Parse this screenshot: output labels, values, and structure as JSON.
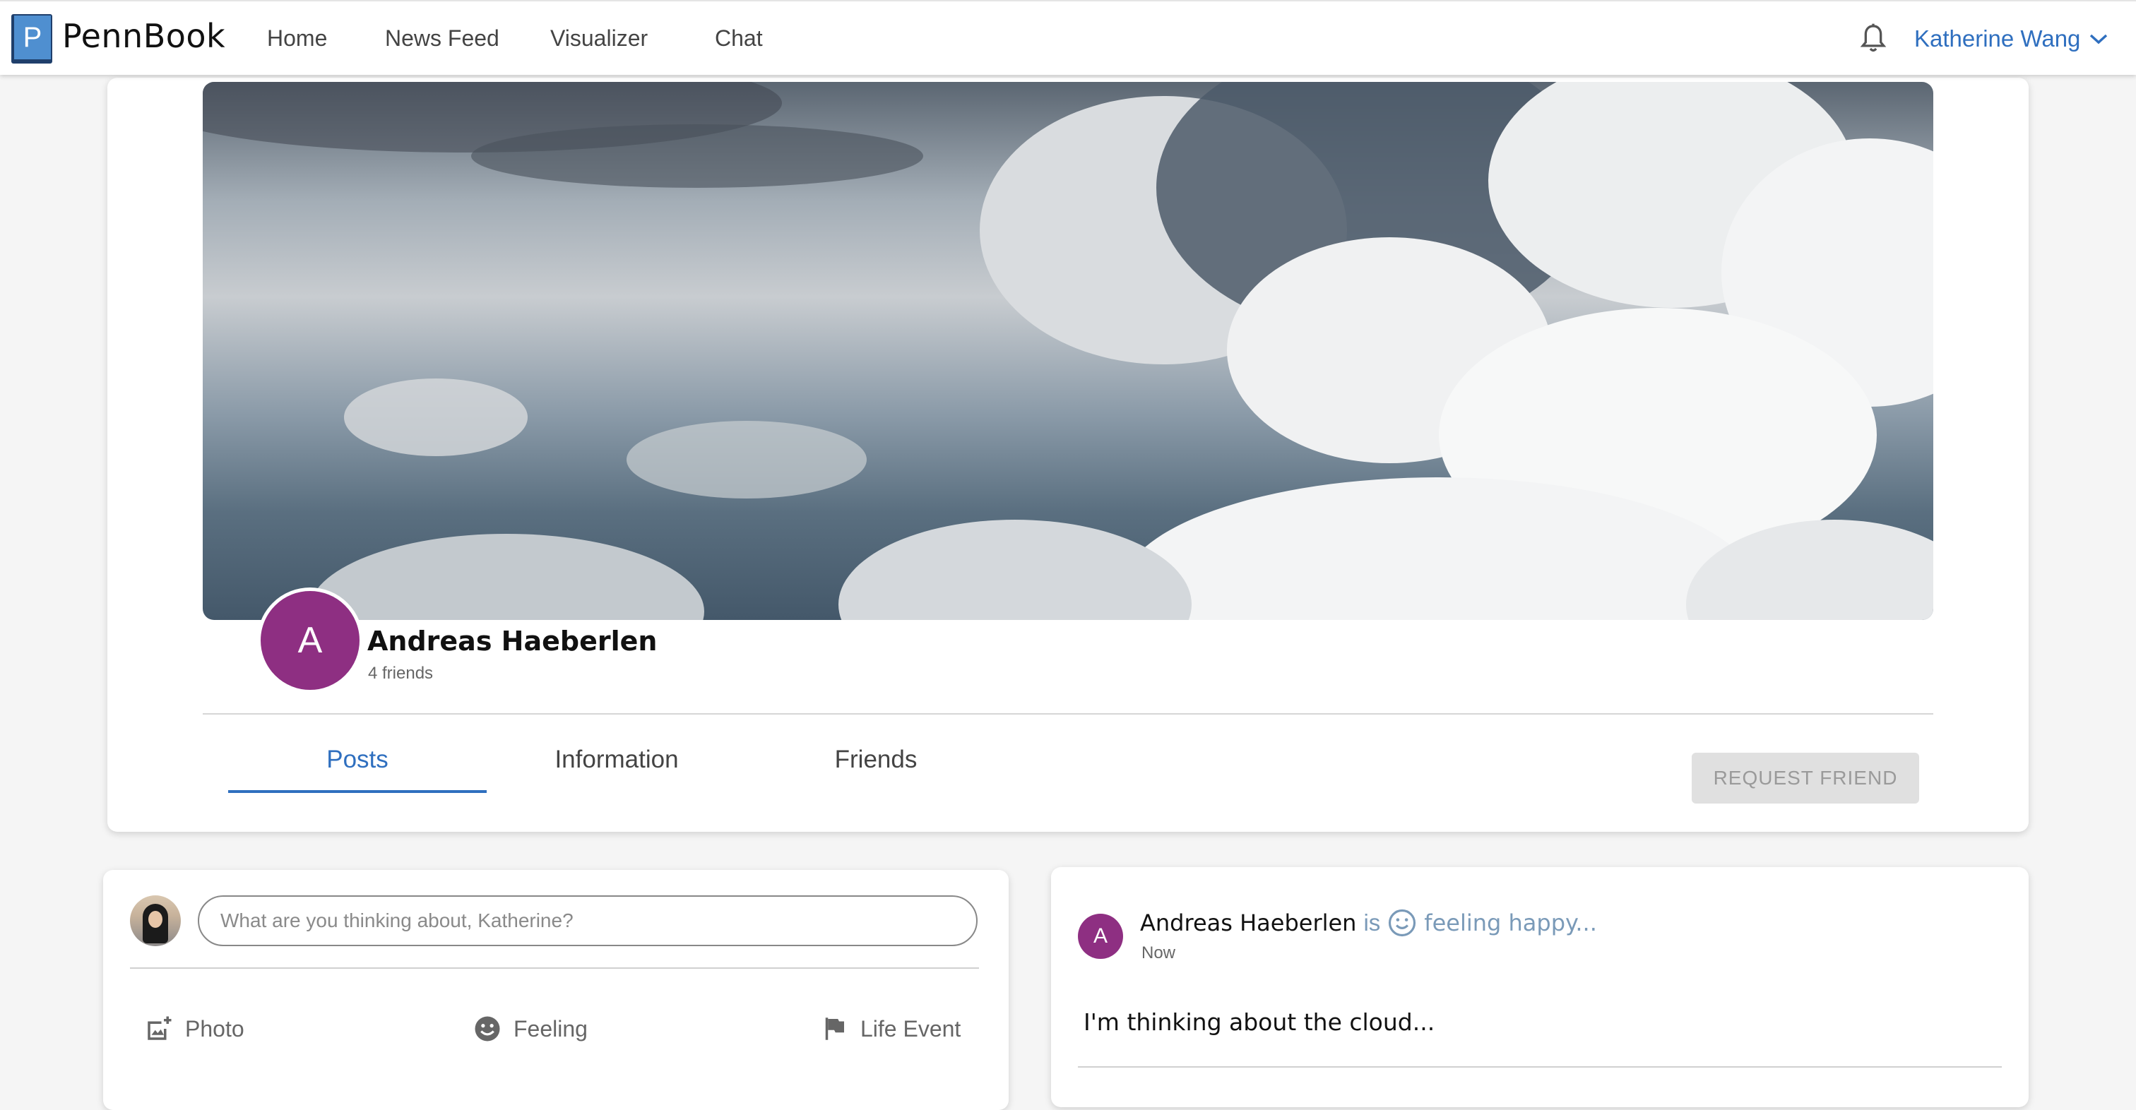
{
  "navbar": {
    "logo_letter": "P",
    "brand": "PennBook",
    "links": [
      "Home",
      "News Feed",
      "Visualizer",
      "Chat"
    ],
    "user_name": "Katherine Wang",
    "accent_color": "#2f6fbf"
  },
  "profile": {
    "avatar_letter": "A",
    "name": "Andreas Haeberlen",
    "friends": "4 friends",
    "avatar_color": "#8e2f82",
    "tabs": [
      "Posts",
      "Information",
      "Friends"
    ],
    "active_tab": "Posts",
    "request_button": "REQUEST FRIEND"
  },
  "composer": {
    "placeholder": "What are you thinking about, Katherine?",
    "actions": [
      "Photo",
      "Feeling",
      "Life Event"
    ]
  },
  "post": {
    "avatar_letter": "A",
    "author": "Andreas Haeberlen",
    "is": "is",
    "feeling": "feeling happy...",
    "time": "Now",
    "body": "I'm thinking about the cloud..."
  }
}
